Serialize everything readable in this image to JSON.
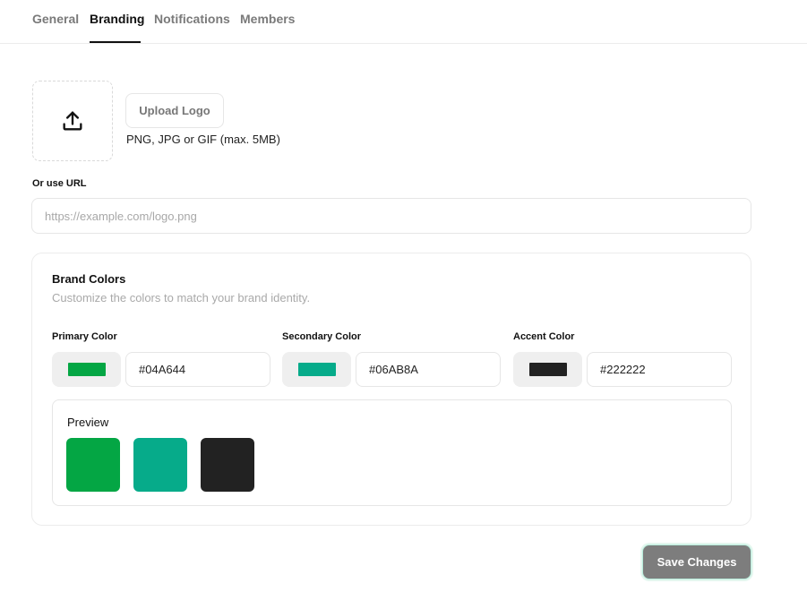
{
  "tabs": [
    {
      "label": "General",
      "active": false
    },
    {
      "label": "Branding",
      "active": true
    },
    {
      "label": "Notifications",
      "active": false
    },
    {
      "label": "Members",
      "active": false
    }
  ],
  "logo": {
    "icon": "upload-icon",
    "upload_button_label": "Upload Logo",
    "hint": "PNG, JPG or GIF (max. 5MB)",
    "url_label": "Or use URL",
    "url_value": "",
    "url_placeholder": "https://example.com/logo.png"
  },
  "brand_colors": {
    "title": "Brand Colors",
    "subtitle": "Customize the colors to match your brand identity.",
    "fields": [
      {
        "label": "Primary Color",
        "value": "#04A644",
        "color": "#04A644"
      },
      {
        "label": "Secondary Color",
        "value": "#06AB8A",
        "color": "#06AB8A"
      },
      {
        "label": "Accent Color",
        "value": "#222222",
        "color": "#222222"
      }
    ],
    "preview": {
      "title": "Preview",
      "swatches": [
        "#04A644",
        "#06AB8A",
        "#222222"
      ]
    }
  },
  "actions": {
    "save_label": "Save Changes",
    "save_color": "#7D7D7D"
  }
}
